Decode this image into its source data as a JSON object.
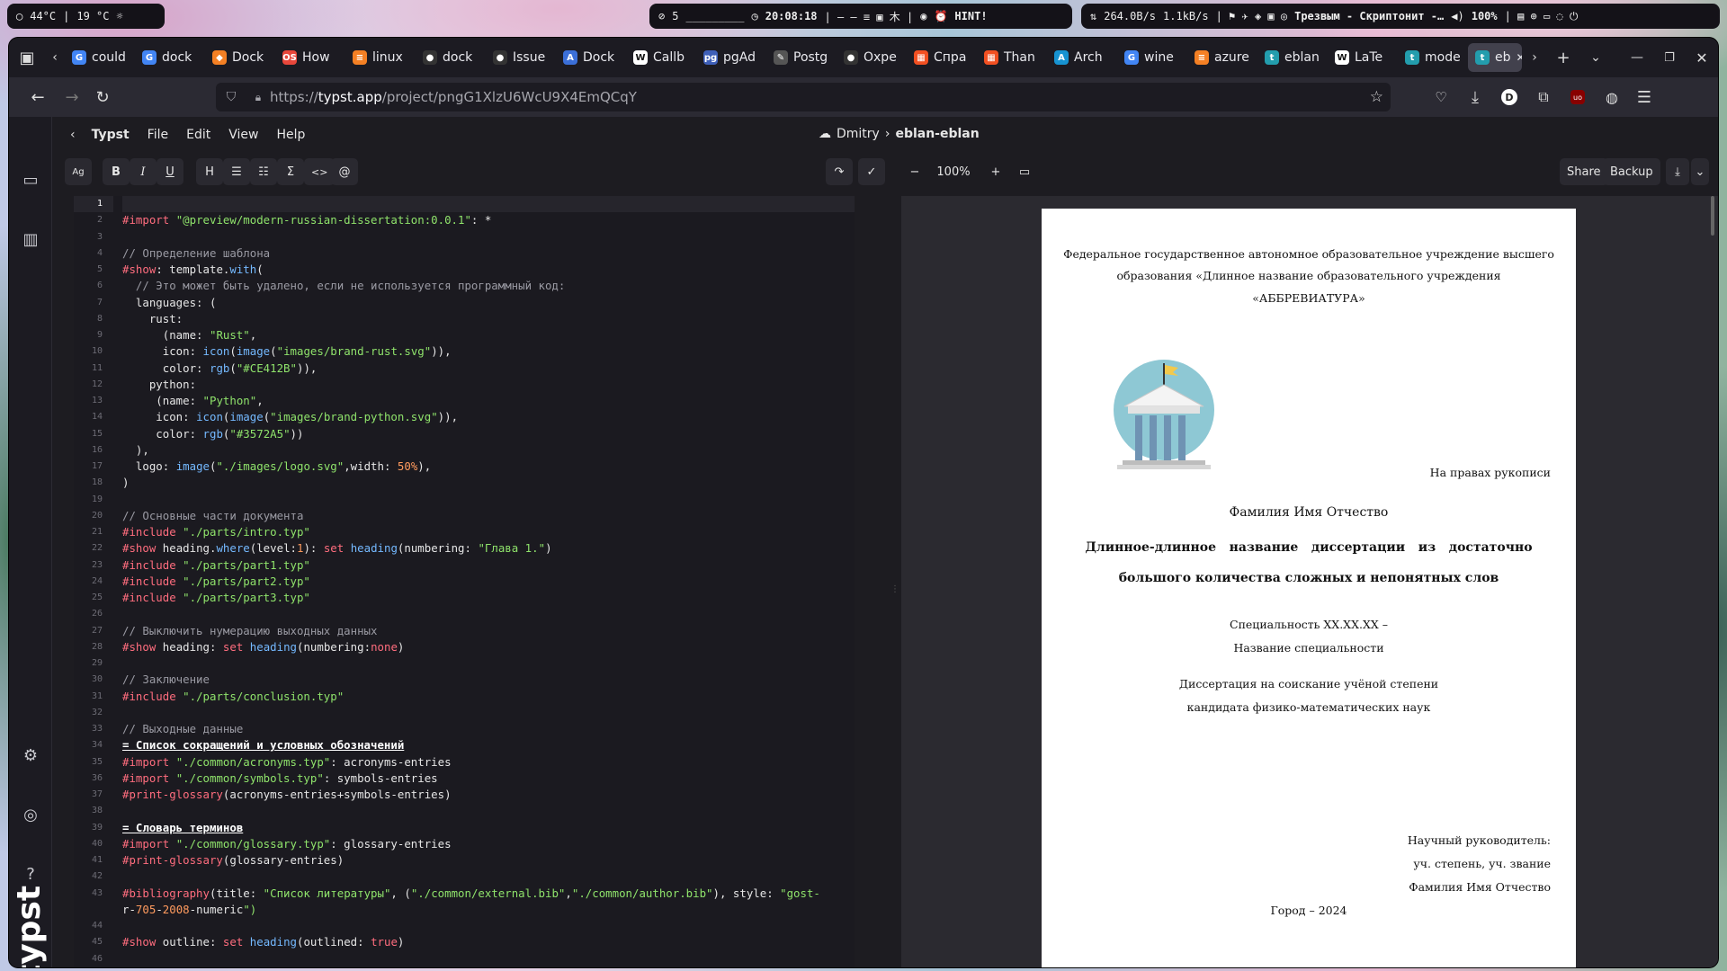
{
  "system_bar": {
    "weather": "44°C",
    "temp2": "19 °C",
    "workspace": "5",
    "clock": "20:08:18",
    "hint": "HINT!",
    "net_down": "264.0B/s",
    "net_up": "1.1kB/s",
    "media": "Трезвым - Скриптонит -…",
    "volume": "100%"
  },
  "browser": {
    "tabs": [
      {
        "label": "could",
        "color": "#4285f4",
        "glyph": "G"
      },
      {
        "label": "dock",
        "color": "#4285f4",
        "glyph": "G"
      },
      {
        "label": "Dock",
        "color": "#f48024",
        "glyph": "◆"
      },
      {
        "label": "How",
        "color": "#e8473b",
        "glyph": "OS"
      },
      {
        "label": "linux",
        "color": "#f48024",
        "glyph": "≡"
      },
      {
        "label": "dock",
        "color": "#333",
        "glyph": "●"
      },
      {
        "label": "Issue",
        "color": "#333",
        "glyph": "●"
      },
      {
        "label": "Dock",
        "color": "#3b6fd8",
        "glyph": "A"
      },
      {
        "label": "Callb",
        "color": "#fff",
        "glyph": "W"
      },
      {
        "label": "pgAd",
        "color": "#3e5fb8",
        "glyph": "pg"
      },
      {
        "label": "Postg",
        "color": "#555",
        "glyph": "✎"
      },
      {
        "label": "Oxpe",
        "color": "#333",
        "glyph": "●"
      },
      {
        "label": "Спра",
        "color": "#f25022",
        "glyph": "▦"
      },
      {
        "label": "Than",
        "color": "#f25022",
        "glyph": "▦"
      },
      {
        "label": "Arch",
        "color": "#1793d1",
        "glyph": "A"
      },
      {
        "label": "wine",
        "color": "#4285f4",
        "glyph": "G"
      },
      {
        "label": "azure",
        "color": "#f48024",
        "glyph": "≡"
      },
      {
        "label": "eblan",
        "color": "#239dad",
        "glyph": "t"
      },
      {
        "label": "LaTe",
        "color": "#fff",
        "glyph": "W"
      },
      {
        "label": "mode",
        "color": "#239dad",
        "glyph": "t"
      },
      {
        "label": "eb",
        "color": "#239dad",
        "glyph": "t"
      }
    ],
    "url_prefix": "https://",
    "url_host": "typst.app",
    "url_path": "/project/pngG1XlzU6WcU9X4EmQCqY",
    "profile_initial": "D"
  },
  "app": {
    "menu": [
      "Typst",
      "File",
      "Edit",
      "View",
      "Help"
    ],
    "owner": "Dmitry",
    "project": "eblan-eblan",
    "toolbar": {
      "aa": "Ag",
      "bold": "B",
      "italic": "I",
      "underline": "U",
      "heading": "H",
      "bullet": "☰",
      "numbered": "☷",
      "math": "Σ",
      "code": "<>",
      "ref": "@",
      "zoom": "100%",
      "share": "Share",
      "backup": "Backup"
    }
  },
  "code_lines": [
    "",
    "#import \"@preview/modern-russian-dissertation:0.0.1\": *",
    "",
    "// Определение шаблона",
    "#show: template.with(",
    "  // Это может быть удалено, если не используется программный код:",
    "  languages: (",
    "    rust:",
    "      (name: \"Rust\",",
    "      icon: icon(image(\"images/brand-rust.svg\")),",
    "      color: rgb(\"#CE412B\")),",
    "    python:",
    "     (name: \"Python\",",
    "     icon: icon(image(\"images/brand-python.svg\")),",
    "     color: rgb(\"#3572A5\"))",
    "  ),",
    "  logo: image(\"./images/logo.svg\",width: 50%),",
    ")",
    "",
    "// Основные части документа",
    "#include \"./parts/intro.typ\"",
    "#show heading.where(level:1): set heading(numbering: \"Глава 1.\")",
    "#include \"./parts/part1.typ\"",
    "#include \"./parts/part2.typ\"",
    "#include \"./parts/part3.typ\"",
    "",
    "// Выключить нумерацию выходных данных",
    "#show heading: set heading(numbering:none)",
    "",
    "// Заключение",
    "#include \"./parts/conclusion.typ\"",
    "",
    "// Выходные данные",
    "= Список сокращений и условных обозначений",
    "#import \"./common/acronyms.typ\": acronyms-entries",
    "#import \"./common/symbols.typ\": symbols-entries",
    "#print-glossary(acronyms-entries+symbols-entries)",
    "",
    "= Словарь терминов",
    "#import \"./common/glossary.typ\": glossary-entries",
    "#print-glossary(glossary-entries)",
    "",
    "#bibliography(title: \"Список литературы\", (\"./common/external.bib\",\"./common/author.bib\"), style: \"gost-",
    "r-705-2008-numeric\")",
    "",
    "#show outline: set heading(outlined: true)"
  ],
  "line_numbers": [
    "1",
    "2",
    "3",
    "4",
    "5",
    "6",
    "7",
    "8",
    "9",
    "10",
    "11",
    "12",
    "13",
    "14",
    "15",
    "16",
    "17",
    "18",
    "19",
    "20",
    "21",
    "22",
    "23",
    "24",
    "25",
    "26",
    "27",
    "28",
    "29",
    "30",
    "31",
    "32",
    "33",
    "34",
    "35",
    "36",
    "37",
    "38",
    "39",
    "40",
    "41",
    "42",
    "43",
    "",
    "44",
    "45",
    "46"
  ],
  "doc": {
    "institution_1": "Федеральное государственное автономное образовательное учреждение высшего",
    "institution_2": "образования «Длинное название образовательного учреждения",
    "institution_3": "«АББРЕВИАТУРА»",
    "rights": "На правах рукописи",
    "author": "Фамилия Имя Отчество",
    "title_1": "Длинное-длинное   название   диссертации   из   достаточно",
    "title_2": "большого количества сложных и непонятных слов",
    "spec_1": "Специальность XX.XX.XX –",
    "spec_2": "Название специальности",
    "degree_1": "Диссертация на соискание учёной степени",
    "degree_2": "кандидата физико-математических наук",
    "supervisor_1": "Научный руководитель:",
    "supervisor_2": "уч. степень, уч. звание",
    "supervisor_3": "Фамилия Имя Отчество",
    "city_year": "Город – 2024"
  }
}
